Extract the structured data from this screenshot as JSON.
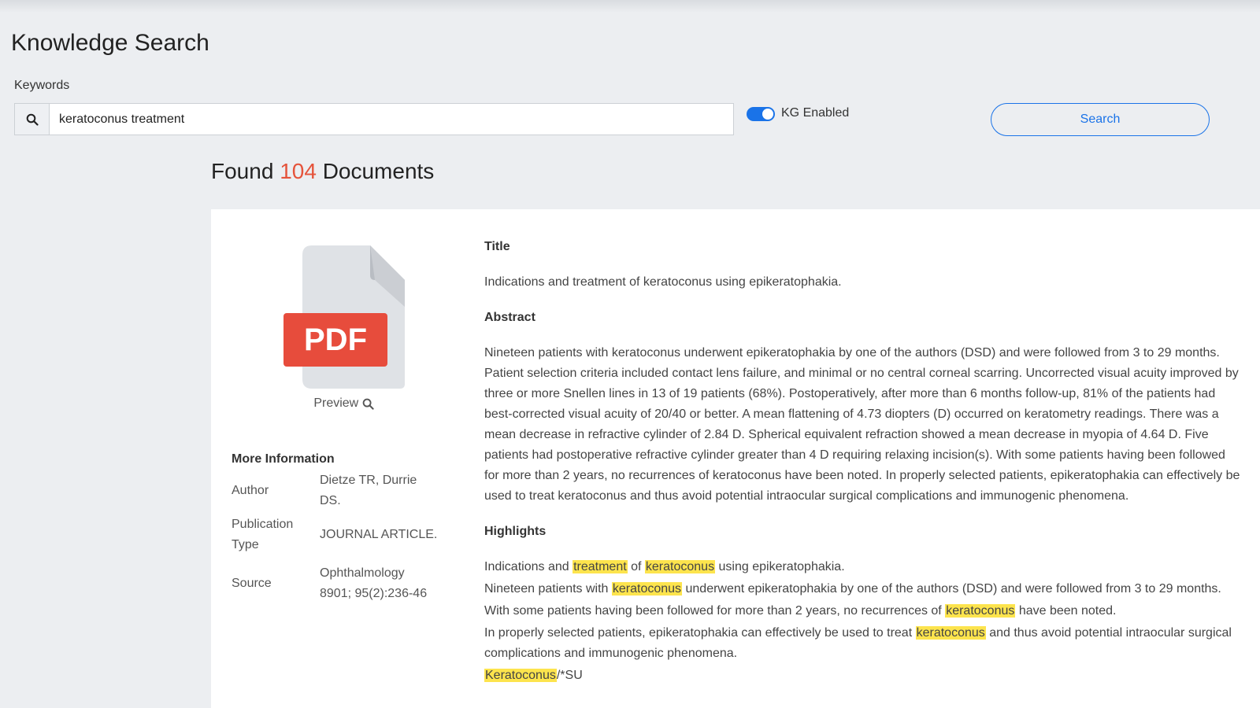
{
  "header": {
    "title": "Knowledge Search"
  },
  "search": {
    "keywords_label": "Keywords",
    "value": "keratoconus treatment",
    "kg_label": "KG Enabled",
    "kg_enabled": true,
    "button_label": "Search"
  },
  "results": {
    "found_prefix": "Found",
    "count": "104",
    "found_suffix": "Documents"
  },
  "document": {
    "file_type": "PDF",
    "preview_label": "Preview",
    "more_info": {
      "heading": "More Information",
      "rows": [
        {
          "key": "Author",
          "value": "Dietze TR, Durrie DS."
        },
        {
          "key": "Publication Type",
          "value": "JOURNAL ARTICLE."
        },
        {
          "key": "Source",
          "value": "Ophthalmology 8901; 95(2):236-46"
        }
      ]
    },
    "title_heading": "Title",
    "title": "Indications and treatment of keratoconus using epikeratophakia.",
    "abstract_heading": "Abstract",
    "abstract": "Nineteen patients with keratoconus underwent epikeratophakia by one of the authors (DSD) and were followed from 3 to 29 months. Patient selection criteria included contact lens failure, and minimal or no central corneal scarring. Uncorrected visual acuity improved by three or more Snellen lines in 13 of 19 patients (68%). Postoperatively, after more than 6 months follow-up, 81% of the patients had best-corrected visual acuity of 20/40 or better. A mean flattening of 4.73 diopters (D) occurred on keratometry readings. There was a mean decrease in refractive cylinder of 2.84 D. Spherical equivalent refraction showed a mean decrease in myopia of 4.64 D. Five patients had postoperative refractive cylinder greater than 4 D requiring relaxing incision(s). With some patients having been followed for more than 2 years, no recurrences of keratoconus have been noted. In properly selected patients, epikeratophakia can effectively be used to treat keratoconus and thus avoid potential intraocular surgical complications and immunogenic phenomena.",
    "highlights_heading": "Highlights",
    "highlights": [
      [
        "Indications and ",
        "treatment",
        " of ",
        "keratoconus",
        " using epikeratophakia."
      ],
      [
        "Nineteen patients with ",
        "keratoconus",
        " underwent epikeratophakia by one of the authors (DSD) and were followed from 3 to 29 months."
      ],
      [
        "With some patients having been followed for more than 2 years, no recurrences of ",
        "keratoconus",
        " have been noted."
      ],
      [
        "In properly selected patients, epikeratophakia can effectively be used to treat ",
        "keratoconus",
        " and thus avoid potential intraocular surgical complications and immunogenic phenomena."
      ],
      [
        "",
        "Keratoconus",
        "/*SU"
      ]
    ]
  },
  "colors": {
    "accent": "#1a73e8",
    "count": "#e5533b",
    "pdf_red": "#e74c3c",
    "highlight": "#fde44d"
  }
}
